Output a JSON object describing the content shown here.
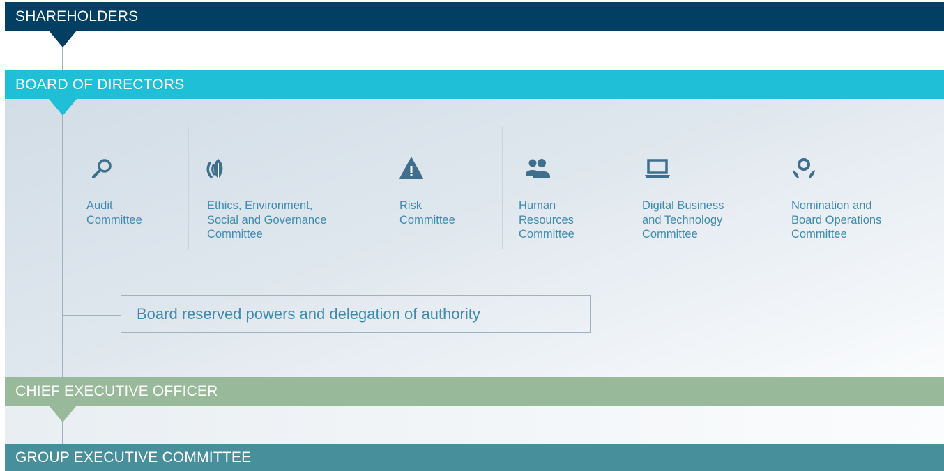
{
  "levels": {
    "shareholders": "SHAREHOLDERS",
    "board": "BOARD OF DIRECTORS",
    "ceo": "CHIEF EXECUTIVE OFFICER",
    "group_exec": "GROUP EXECUTIVE COMMITTEE"
  },
  "committees": [
    {
      "label": "Audit\nCommittee",
      "icon": "magnifier-icon"
    },
    {
      "label": "Ethics, Environment,\nSocial and Governance\nCommittee",
      "icon": "leaf-icon"
    },
    {
      "label": "Risk\nCommittee",
      "icon": "warning-icon"
    },
    {
      "label": "Human\nResources\nCommittee",
      "icon": "people-icon"
    },
    {
      "label": "Digital Business\nand Technology\nCommittee",
      "icon": "laptop-icon"
    },
    {
      "label": "Nomination and\nBoard Operations\nCommittee",
      "icon": "nomination-icon"
    }
  ],
  "powers_box": "Board reserved powers and delegation of authority",
  "colors": {
    "shareholders": "#033f63",
    "board": "#1fbfd8",
    "ceo": "#98b99a",
    "group_exec": "#468f9b",
    "icon": "#3f6f8c",
    "text": "#3f8bb0"
  }
}
